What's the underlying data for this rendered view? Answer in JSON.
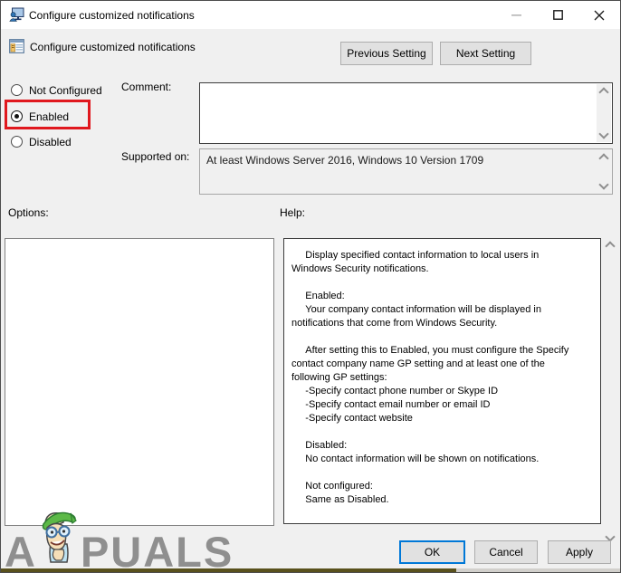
{
  "window": {
    "title": "Configure customized notifications"
  },
  "header": {
    "setting_title": "Configure customized notifications",
    "previous_label": "Previous Setting",
    "next_label": "Next Setting"
  },
  "radios": [
    {
      "label": "Not Configured",
      "selected": false,
      "highlighted": false
    },
    {
      "label": "Enabled",
      "selected": true,
      "highlighted": true
    },
    {
      "label": "Disabled",
      "selected": false,
      "highlighted": false
    }
  ],
  "comment": {
    "label": "Comment:",
    "value": ""
  },
  "supported": {
    "label": "Supported on:",
    "value": "At least Windows Server 2016, Windows 10 Version 1709"
  },
  "options": {
    "label": "Options:"
  },
  "help": {
    "label": "Help:",
    "text": "     Display specified contact information to local users in\nWindows Security notifications.\n\n     Enabled:\n     Your company contact information will be displayed in\nnotifications that come from Windows Security.\n\n     After setting this to Enabled, you must configure the Specify\ncontact company name GP setting and at least one of the\nfollowing GP settings:\n     -Specify contact phone number or Skype ID\n     -Specify contact email number or email ID\n     -Specify contact website\n\n     Disabled:\n     No contact information will be shown on notifications.\n\n     Not configured:\n     Same as Disabled."
  },
  "footer": {
    "ok_label": "OK",
    "cancel_label": "Cancel",
    "apply_label": "Apply"
  },
  "watermark": {
    "part1": "A",
    "part2": "PUALS"
  },
  "colors": {
    "accent_focus": "#0078d7",
    "highlight_red": "#e0181e",
    "dialog_bg": "#f0f0f0",
    "button_bg": "#e1e1e1"
  }
}
